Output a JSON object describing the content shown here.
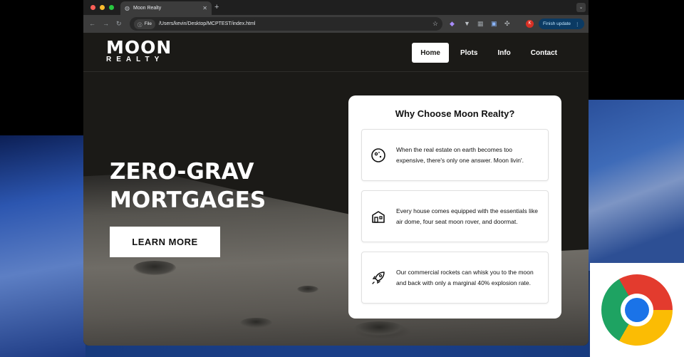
{
  "browser": {
    "tab_title": "Moon Realty",
    "url_chip": "File",
    "url": "/Users/kevin/Desktop/MCPTEST/index.html",
    "profile_initial": "K",
    "update_label": "Finish update"
  },
  "site": {
    "logo_main": "MOON",
    "logo_sub": "REALTY",
    "nav": [
      "Home",
      "Plots",
      "Info",
      "Contact"
    ],
    "hero_line1": "ZERO-GRAV",
    "hero_line2": "MORTGAGES",
    "cta": "LEARN MORE",
    "why_title": "Why Choose Moon Realty?",
    "features": [
      {
        "icon": "moon-icon",
        "text": "When the real estate on earth becomes too expensive, there's only one answer. Moon livin'."
      },
      {
        "icon": "house-icon",
        "text": "Every house comes equipped with the essentials like air dome, four seat moon rover, and doormat."
      },
      {
        "icon": "rocket-icon",
        "text": "Our commercial rockets can whisk you to the moon and back with only a marginal 40% explosion rate."
      }
    ]
  }
}
